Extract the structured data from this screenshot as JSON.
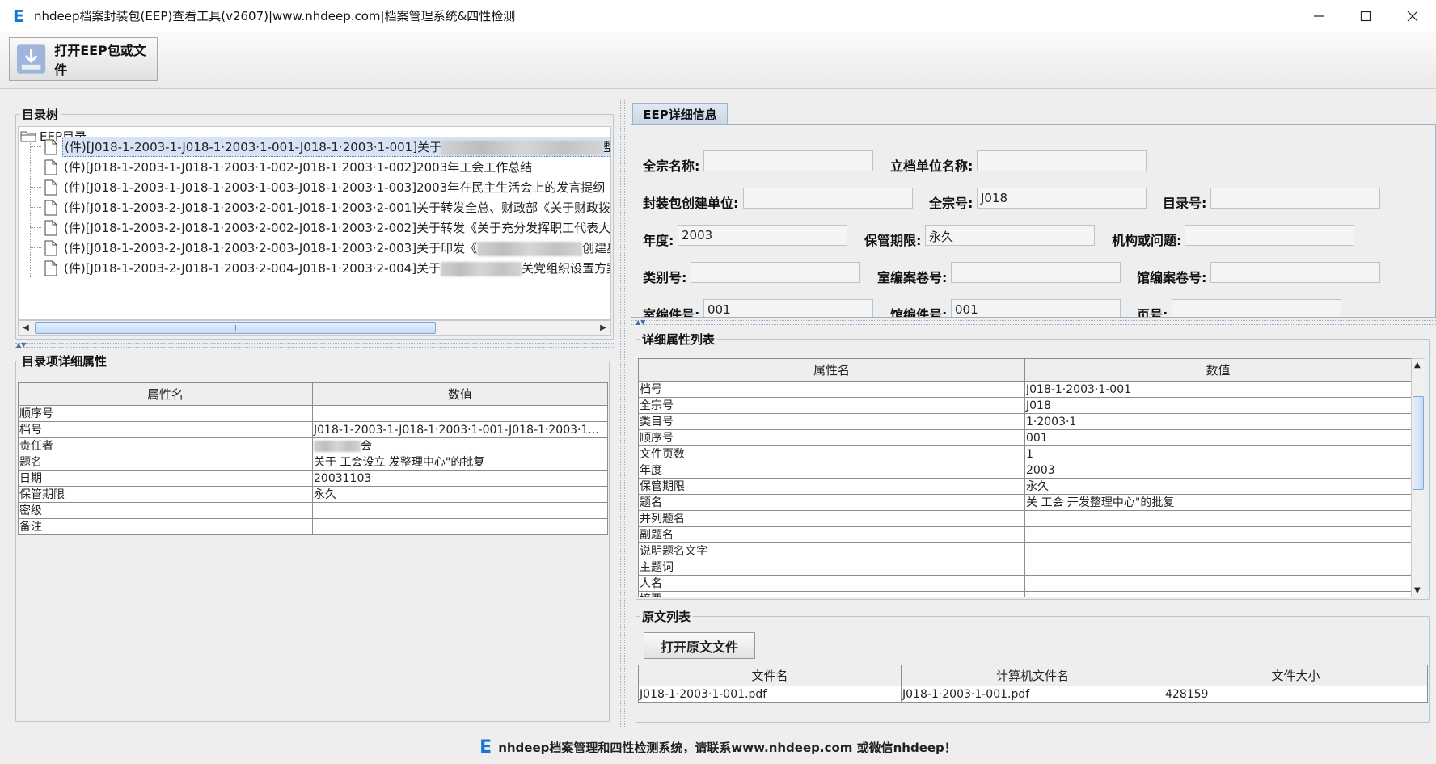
{
  "window": {
    "title": "nhdeep档案封装包(EEP)查看工具(v2607)|www.nhdeep.com|档案管理系统&四性检测",
    "logo_letter": "E"
  },
  "toolbar": {
    "open_label": "打开EEP包或文件"
  },
  "tree": {
    "group_title": "目录树",
    "root_label": "EEP目录",
    "items": [
      "(件)[J018-1-2003-1-J018-1·2003·1-001-J018-1·2003·1-001]关于",
      "(件)[J018-1-2003-1-J018-1·2003·1-002-J018-1·2003·1-002]2003年工会工作总结",
      "(件)[J018-1-2003-1-J018-1·2003·1-003-J018-1·2003·1-003]2003年在民主生活会上的发言提纲",
      "(件)[J018-1-2003-2-J018-1·2003·2-001-J018-1·2003·2-001]关于转发全总、财政部《关于财政拨款的",
      "(件)[J018-1-2003-2-J018-1·2003·2-002-J018-1·2003·2-002]关于转发《关于充分发挥职工代表大会在",
      "(件)[J018-1-2003-2-J018-1·2003·2-003-J018-1·2003·2-003]关于印发《",
      "(件)[J018-1-2003-2-J018-1·2003·2-004-J018-1·2003·2-004]关于"
    ],
    "items_tail": [
      "整理中",
      "",
      "",
      "",
      "",
      "创建星级",
      "关党组织设置方案"
    ]
  },
  "item_props": {
    "group_title": "目录项详细属性",
    "headers": [
      "属性名",
      "数值"
    ],
    "rows": [
      [
        "顺序号",
        ""
      ],
      [
        "档号",
        "J018-1-2003-1-J018-1·2003·1-001-J018-1·2003·1..."
      ],
      [
        "责任者",
        "会"
      ],
      [
        "题名",
        "关于          工会设立            发整理中心\"的批复"
      ],
      [
        "日期",
        "20031103"
      ],
      [
        "保管期限",
        "永久"
      ],
      [
        "密级",
        ""
      ],
      [
        "备注",
        ""
      ]
    ]
  },
  "eep_detail": {
    "tab_label": "EEP详细信息",
    "fields": {
      "qzmc": {
        "label": "全宗名称:",
        "value": ""
      },
      "ldwmc": {
        "label": "立档单位名称:",
        "value": ""
      },
      "fzbdw": {
        "label": "封装包创建单位:",
        "value": ""
      },
      "qzh": {
        "label": "全宗号:",
        "value": "J018"
      },
      "mlh": {
        "label": "目录号:",
        "value": ""
      },
      "nd": {
        "label": "年度:",
        "value": "2003"
      },
      "bgqx": {
        "label": "保管期限:",
        "value": "永久"
      },
      "jgwt": {
        "label": "机构或问题:",
        "value": ""
      },
      "lbh": {
        "label": "类别号:",
        "value": ""
      },
      "sbajh": {
        "label": "室编案卷号:",
        "value": ""
      },
      "gbajh": {
        "label": "馆编案卷号:",
        "value": ""
      },
      "sbjh": {
        "label": "室编件号:",
        "value": "001"
      },
      "gbjh": {
        "label": "馆编件号:",
        "value": "001"
      },
      "yh": {
        "label": "页号:",
        "value": ""
      }
    }
  },
  "detail_list": {
    "group_title": "详细属性列表",
    "headers": [
      "属性名",
      "数值"
    ],
    "rows": [
      [
        "档号",
        "J018-1·2003·1-001"
      ],
      [
        "全宗号",
        "J018"
      ],
      [
        "类目号",
        "1·2003·1"
      ],
      [
        "顺序号",
        "001"
      ],
      [
        "文件页数",
        "1"
      ],
      [
        "年度",
        "2003"
      ],
      [
        "保管期限",
        "永久"
      ],
      [
        "题名",
        "关          工会                开发整理中心\"的批复"
      ],
      [
        "并列题名",
        ""
      ],
      [
        "副题名",
        ""
      ],
      [
        "说明题名文字",
        ""
      ],
      [
        "主题词",
        ""
      ],
      [
        "人名",
        ""
      ],
      [
        "摘要",
        ""
      ]
    ]
  },
  "raw_files": {
    "group_title": "原文列表",
    "open_label": "打开原文文件",
    "headers": [
      "文件名",
      "计算机文件名",
      "文件大小"
    ],
    "rows": [
      [
        "J018-1·2003·1-001.pdf",
        "J018-1·2003·1-001.pdf",
        "428159"
      ]
    ]
  },
  "status": {
    "logo_letter": "E",
    "text": "nhdeep档案管理和四性检测系统，请联系www.nhdeep.com 或微信nhdeep！"
  },
  "colors": {
    "accent": "#1a73d8",
    "selection": "#d5e3f5",
    "border": "#8d8d8d"
  }
}
